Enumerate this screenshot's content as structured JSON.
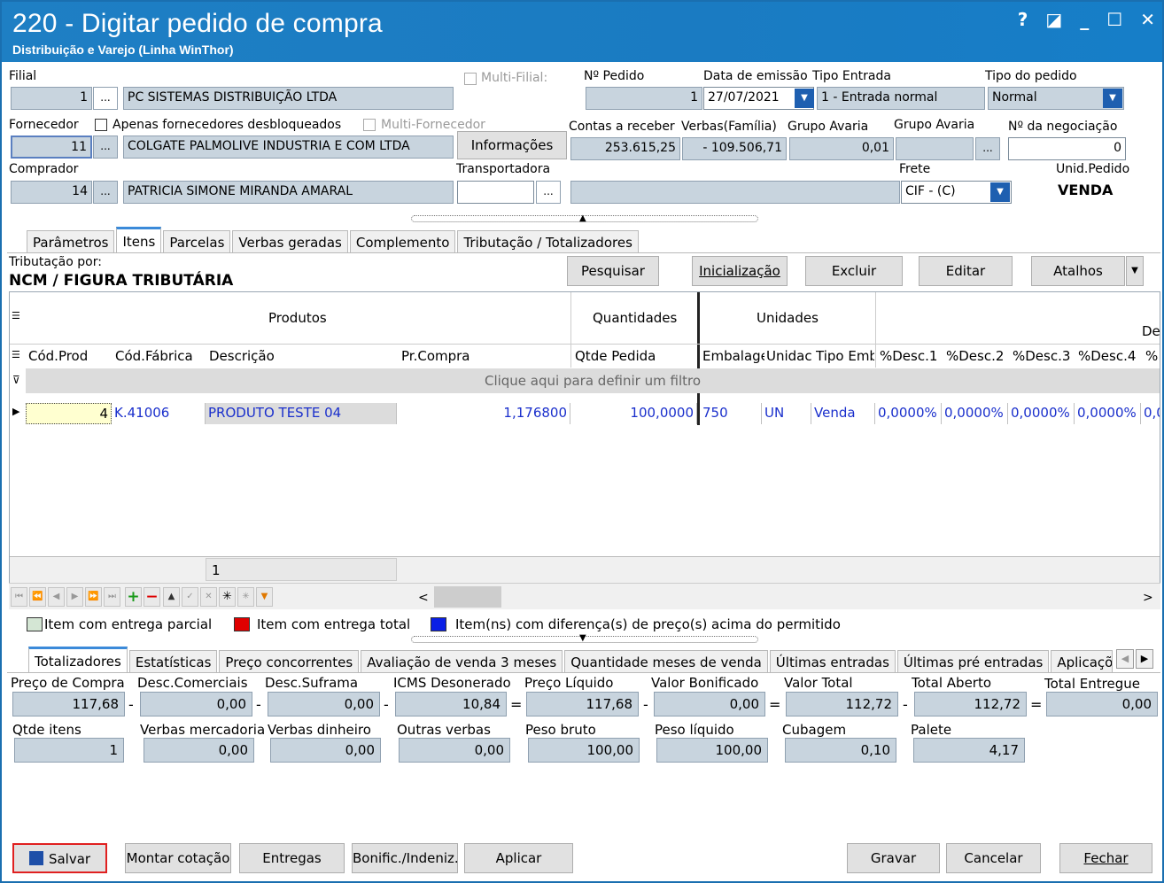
{
  "window": {
    "title": "220 - Digitar pedido de compra",
    "subtitle": "Distribuição e Varejo (Linha WinThor)",
    "help": "?",
    "restore": "◪",
    "minimize": "_",
    "maximize": "☐",
    "close": "✕"
  },
  "header": {
    "filial_label": "Filial",
    "filial_code": "1",
    "filial_name": "PC SISTEMAS DISTRIBUIÇÃO LTDA",
    "multi_filial_label": "Multi-Filial:",
    "num_pedido_label": "Nº Pedido",
    "num_pedido": "1",
    "data_emissao_label": "Data de emissão",
    "data_emissao": "27/07/2021",
    "tipo_entrada_label": "Tipo Entrada",
    "tipo_entrada": "1 - Entrada normal",
    "tipo_pedido_label": "Tipo do pedido",
    "tipo_pedido": "Normal",
    "fornecedor_label": "Fornecedor",
    "apenas_desbloqueados_label": "Apenas fornecedores desbloqueados",
    "multi_fornecedor_label": "Multi-Fornecedor",
    "fornecedor_code": "11",
    "fornecedor_name": "COLGATE PALMOLIVE INDUSTRIA  E COM LTDA",
    "informacoes_label": "Informações",
    "contas_receber_label": "Contas a receber",
    "contas_receber": "253.615,25",
    "verbas_familia_label": "Verbas(Família)",
    "verbas_familia": "- 109.506,71",
    "grupo_avaria_label": "Grupo Avaria",
    "grupo_avaria_1": "0,01",
    "grupo_avaria_2_label": "Grupo Avaria",
    "negociacao_label": "Nº da negociação",
    "negociacao": "0",
    "comprador_label": "Comprador",
    "comprador_code": "14",
    "comprador_name": "PATRICIA SIMONE MIRANDA AMARAL",
    "transportadora_label": "Transportadora",
    "frete_label": "Frete",
    "frete": "CIF - (C)",
    "unid_pedido_label": "Unid.Pedido",
    "unid_pedido": "VENDA",
    "ellipsis": "..."
  },
  "tabs_top": [
    "Parâmetros",
    "Itens",
    "Parcelas",
    "Verbas geradas",
    "Complemento",
    "Tributação / Totalizadores"
  ],
  "items_panel": {
    "tributacao_label": "Tributação por:",
    "tributacao_value": "NCM / FIGURA TRIBUTÁRIA",
    "pesquisar": "Pesquisar",
    "inicializacao": "Inicialização",
    "excluir": "Excluir",
    "editar": "Editar",
    "atalhos": "Atalhos"
  },
  "grid": {
    "band_produtos": "Produtos",
    "band_quantidades": "Quantidades",
    "band_unidades": "Unidades",
    "band_de": "De",
    "columns": [
      "Cód.Prod",
      "Cód.Fábrica",
      "Descrição",
      "Pr.Compra",
      "Qtde Pedida",
      "Embalage",
      "Unidac",
      "Tipo Emb",
      "%Desc.1",
      "%Desc.2",
      "%Desc.3",
      "%Desc.4",
      "%"
    ],
    "filter_text": "Clique aqui para definir um filtro",
    "row": [
      "4",
      "K.41006",
      "PRODUTO TESTE 04",
      "1,176800",
      "100,0000",
      "750",
      "UN",
      "Venda",
      "0,0000%",
      "0,0000%",
      "0,0000%",
      "0,0000%",
      "0,0"
    ],
    "footer_count": "1"
  },
  "legend": {
    "parcial": "Item com entrega parcial",
    "total": "Item com entrega total",
    "diferenca": "Item(ns) com diferença(s) de preço(s) acima do permitido",
    "colors": {
      "parcial": "#d4e6d4",
      "total": "#e00000",
      "diferenca": "#0a1fe6"
    }
  },
  "tabs_bottom": [
    "Totalizadores",
    "Estatísticas",
    "Preço concorrentes",
    "Avaliação de venda 3 meses",
    "Quantidade meses de venda",
    "Últimas entradas",
    "Últimas pré entradas",
    "Aplicaçõe"
  ],
  "totalizadores": {
    "preco_compra_label": "Preço de Compra",
    "preco_compra": "117,68",
    "desc_comerciais_label": "Desc.Comerciais",
    "desc_comerciais": "0,00",
    "desc_suframa_label": "Desc.Suframa",
    "desc_suframa": "0,00",
    "icms_label": "ICMS Desonerado",
    "icms": "10,84",
    "preco_liquido_label": "Preço Líquido",
    "preco_liquido": "117,68",
    "valor_bonificado_label": "Valor Bonificado",
    "valor_bonificado": "0,00",
    "valor_total_label": "Valor Total",
    "valor_total": "112,72",
    "total_aberto_label": "Total Aberto",
    "total_aberto": "112,72",
    "total_entregue_label": "Total Entregue",
    "total_entregue": "0,00",
    "qtde_itens_label": "Qtde itens",
    "qtde_itens": "1",
    "verbas_mercadoria_label": "Verbas mercadoria",
    "verbas_mercadoria": "0,00",
    "verbas_dinheiro_label": "Verbas dinheiro",
    "verbas_dinheiro": "0,00",
    "outras_verbas_label": "Outras verbas",
    "outras_verbas": "0,00",
    "peso_bruto_label": "Peso bruto",
    "peso_bruto": "100,00",
    "peso_liquido_label": "Peso líquido",
    "peso_liquido": "100,00",
    "cubagem_label": "Cubagem",
    "cubagem": "0,10",
    "palete_label": "Palete",
    "palete": "4,17",
    "minus": "-",
    "equals": "="
  },
  "footer": {
    "salvar": "Salvar",
    "montar_cotacao": "Montar cotação",
    "entregas": "Entregas",
    "bonific": "Bonific./Indeniz.",
    "aplicar": "Aplicar",
    "gravar": "Gravar",
    "cancelar": "Cancelar",
    "fechar": "Fechar"
  }
}
